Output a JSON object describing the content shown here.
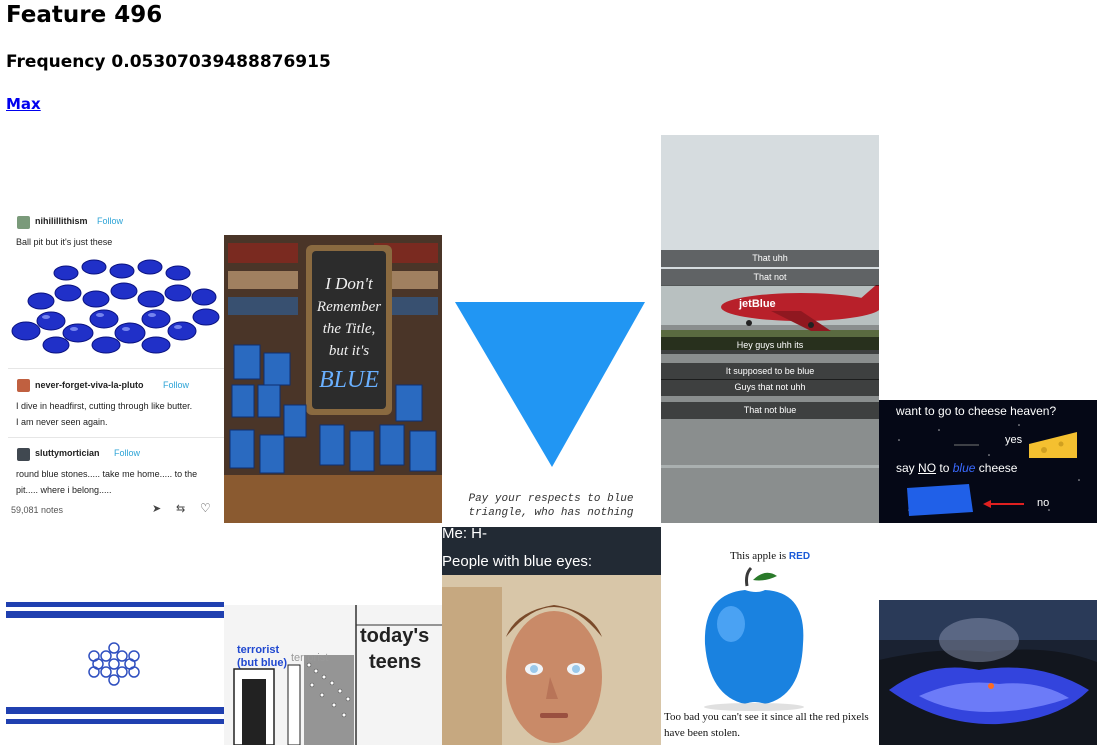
{
  "page": {
    "title": "Feature 496",
    "frequency": "Frequency 0.05307039488876915",
    "max_link": "Max"
  },
  "tumblr": {
    "user1": "nihilillithism",
    "follow": "Follow",
    "post1": "Ball pit but it's just these",
    "user2": "never-forget-viva-la-pluto",
    "post2_line1": "I dive in headfirst, cutting through like butter.",
    "post2_line2": "I am never seen again.",
    "user3": "sluttymortician",
    "post3_line1": "round blue stones..... take me home..... to the",
    "post3_line2": "pit..... where i belong.....",
    "notes": "59,081 notes"
  },
  "books": {
    "sign_text": "I Don't Remember the Title, but it's BLUE"
  },
  "triangle": {
    "caption_line1": "Pay your respects to blue",
    "caption_line2": "triangle, who has nothing",
    "color": "#2196f3"
  },
  "jetblue": {
    "captions": [
      "That uhh",
      "That not",
      "Hey guys uhh its",
      "It supposed to be blue",
      "Guys that not uhh",
      "That not blue"
    ],
    "plane_text": "jetBlue"
  },
  "cheese": {
    "line1": "want to go to cheese heaven?",
    "yes": "yes",
    "say": "say",
    "no_word": "NO",
    "to": "to",
    "blue_word": "blue",
    "cheese_word": "cheese",
    "no": "no"
  },
  "terrorist": {
    "label1": "terrorist",
    "label1b": "(but blue)",
    "label2": "terrorist",
    "title_line1": "today's",
    "title_line2": "teens"
  },
  "eyes": {
    "line1": "Me: H-",
    "line2": "People with blue eyes:"
  },
  "apple": {
    "title_prefix": "This apple is",
    "red_word": "RED",
    "bottom_line1": "Too bad you can't see it since all the red pixels",
    "bottom_line2": "have been stolen."
  }
}
